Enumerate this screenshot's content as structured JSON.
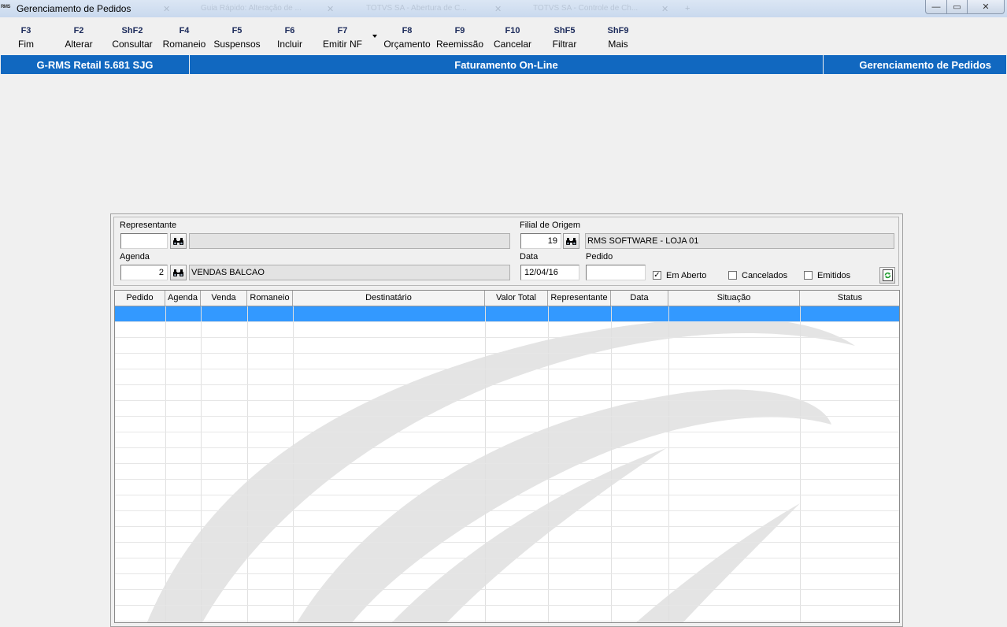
{
  "window": {
    "app_icon_text": "RMS",
    "title": "Gerenciamento de Pedidos",
    "taskbar_ghost_tabs": [
      "Guia Rápido: Alteração de ...",
      "TOTVS SA - Abertura de C...",
      "TOTVS SA - Controle de Ch..."
    ],
    "controls": {
      "minimize": "—",
      "maximize": "▭",
      "close": "✕"
    }
  },
  "toolbar": {
    "buttons": [
      {
        "key": "F3",
        "label": "Fim"
      },
      {
        "key": "F2",
        "label": "Alterar"
      },
      {
        "key": "ShF2",
        "label": "Consultar"
      },
      {
        "key": "F4",
        "label": "Romaneio"
      },
      {
        "key": "F5",
        "label": "Suspensos"
      },
      {
        "key": "F6",
        "label": "Incluir"
      },
      {
        "key": "F7",
        "label": "Emitir NF"
      },
      {
        "key": "F8",
        "label": "Orçamento"
      },
      {
        "key": "F9",
        "label": "Reemissão"
      },
      {
        "key": "F10",
        "label": "Cancelar"
      },
      {
        "key": "ShF5",
        "label": "Filtrar"
      },
      {
        "key": "ShF9",
        "label": "Mais"
      }
    ]
  },
  "header": {
    "system": "G-RMS Retail 5.681 SJG",
    "module": "Faturamento On-Line",
    "screen": "Gerenciamento de Pedidos"
  },
  "filters": {
    "representante": {
      "label": "Representante",
      "code": "",
      "description": ""
    },
    "filial": {
      "label": "Filial de Origem",
      "code": "19",
      "description": "RMS SOFTWARE - LOJA 01"
    },
    "agenda": {
      "label": "Agenda",
      "code": "2",
      "description": "VENDAS BALCAO"
    },
    "data": {
      "label": "Data",
      "value": "12/04/16"
    },
    "pedido": {
      "label": "Pedido",
      "value": ""
    },
    "checkboxes": [
      {
        "label": "Em Aberto",
        "checked": true,
        "mark": "✓"
      },
      {
        "label": "Cancelados",
        "checked": false,
        "mark": ""
      },
      {
        "label": "Emitidos",
        "checked": false,
        "mark": ""
      }
    ]
  },
  "grid": {
    "columns": [
      "Pedido",
      "Agenda",
      "Venda",
      "Romaneio",
      "Destinatário",
      "Valor Total",
      "Representante",
      "Data",
      "Situação",
      "Status"
    ],
    "rows": [],
    "selection_color": "#3399ff"
  },
  "colors": {
    "band": "#1168c0",
    "selection": "#3399ff",
    "watermark": "#e4e4e4"
  }
}
